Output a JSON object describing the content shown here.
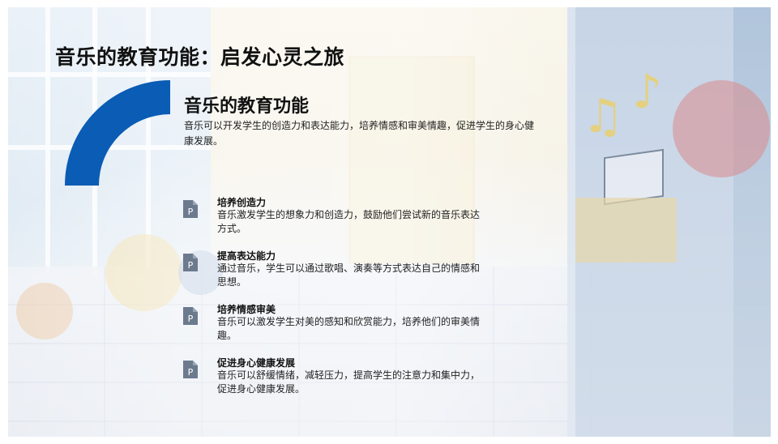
{
  "slide": {
    "title": "音乐的教育功能：启发心灵之旅",
    "accent_color": "#0a5cb4",
    "intro": {
      "heading": "音乐的教育功能",
      "description": "音乐可以开发学生的创造力和表达能力，培养情感和审美情趣，促进学生的身心健康发展。"
    },
    "items": [
      {
        "icon": "document-p-icon",
        "title": "培养创造力",
        "description": "音乐激发学生的想象力和创造力，鼓励他们尝试新的音乐表达方式。"
      },
      {
        "icon": "document-p-icon",
        "title": "提高表达能力",
        "description": "通过音乐，学生可以通过歌唱、演奏等方式表达自己的情感和思想。"
      },
      {
        "icon": "document-p-icon",
        "title": "培养情感审美",
        "description": "音乐可以激发学生对美的感知和欣赏能力，培养他们的审美情趣。"
      },
      {
        "icon": "document-p-icon",
        "title": "促进身心健康发展",
        "description": "音乐可以舒缓情绪，减轻压力，提高学生的注意力和集中力，促进身心健康发展。"
      }
    ],
    "icon_glyph": "P"
  }
}
